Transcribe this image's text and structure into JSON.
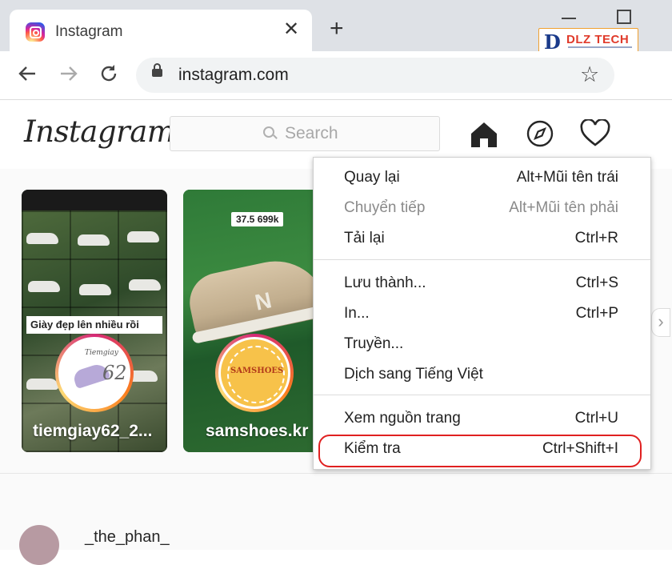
{
  "browser": {
    "tab_title": "Instagram",
    "tab_close": "✕",
    "new_tab": "+",
    "url": "instagram.com",
    "icons": [
      "back-icon",
      "forward-icon",
      "reload-icon",
      "lock-icon",
      "star-icon"
    ]
  },
  "watermark": {
    "brand": "DLZ TECH",
    "mark": "D"
  },
  "instagram": {
    "logo": "Instagram",
    "search_placeholder": "Search",
    "nav_icons": [
      "home-icon",
      "explore-icon",
      "heart-icon"
    ],
    "stories": [
      {
        "name": "tiemgiay62_2...",
        "caption": "Giày đẹp lên nhiều rồi",
        "avatar_text_top": "Tiemgiay",
        "avatar_text": "62"
      },
      {
        "name": "samshoes.kr",
        "price_tag": "37.5 699k",
        "avatar_text": "SAMSHOES"
      }
    ],
    "next_arrow": "›",
    "post_user": "_the_phan_"
  },
  "context_menu": {
    "items": [
      {
        "label": "Quay lại",
        "shortcut": "Alt+Mũi tên trái",
        "enabled": true
      },
      {
        "label": "Chuyển tiếp",
        "shortcut": "Alt+Mũi tên phải",
        "enabled": false
      },
      {
        "label": "Tải lại",
        "shortcut": "Ctrl+R",
        "enabled": true
      },
      {
        "label": "Lưu thành...",
        "shortcut": "Ctrl+S",
        "enabled": true
      },
      {
        "label": "In...",
        "shortcut": "Ctrl+P",
        "enabled": true
      },
      {
        "label": "Truyền...",
        "shortcut": "",
        "enabled": true
      },
      {
        "label": "Dịch sang Tiếng Việt",
        "shortcut": "",
        "enabled": true
      },
      {
        "label": "Xem nguồn trang",
        "shortcut": "Ctrl+U",
        "enabled": true
      },
      {
        "label": "Kiểm tra",
        "shortcut": "Ctrl+Shift+I",
        "enabled": true,
        "highlighted": true
      }
    ]
  },
  "colors": {
    "highlight": "#e02020",
    "ig_text": "#262626",
    "disabled_text": "#8a8a8a"
  }
}
